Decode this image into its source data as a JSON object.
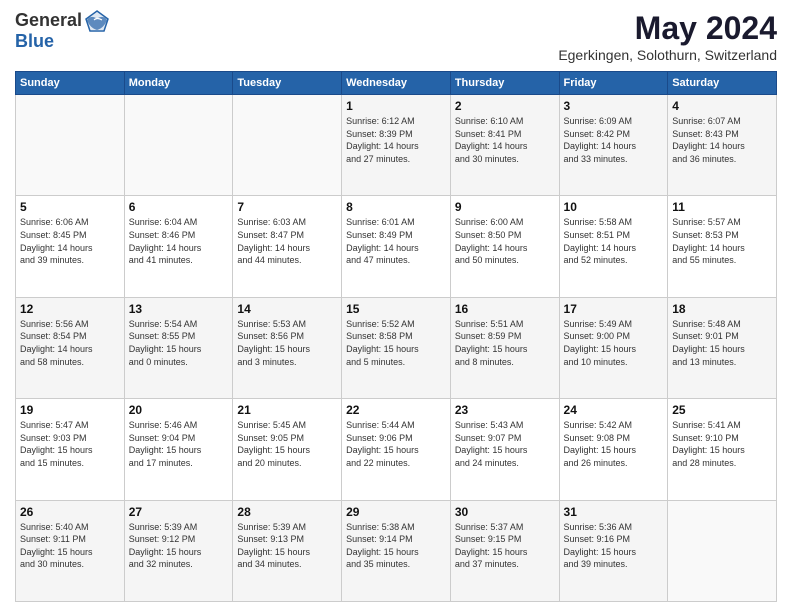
{
  "header": {
    "logo_line1": "General",
    "logo_line2": "Blue",
    "month_title": "May 2024",
    "location": "Egerkingen, Solothurn, Switzerland"
  },
  "weekdays": [
    "Sunday",
    "Monday",
    "Tuesday",
    "Wednesday",
    "Thursday",
    "Friday",
    "Saturday"
  ],
  "weeks": [
    [
      {
        "day": "",
        "info": ""
      },
      {
        "day": "",
        "info": ""
      },
      {
        "day": "",
        "info": ""
      },
      {
        "day": "1",
        "info": "Sunrise: 6:12 AM\nSunset: 8:39 PM\nDaylight: 14 hours\nand 27 minutes."
      },
      {
        "day": "2",
        "info": "Sunrise: 6:10 AM\nSunset: 8:41 PM\nDaylight: 14 hours\nand 30 minutes."
      },
      {
        "day": "3",
        "info": "Sunrise: 6:09 AM\nSunset: 8:42 PM\nDaylight: 14 hours\nand 33 minutes."
      },
      {
        "day": "4",
        "info": "Sunrise: 6:07 AM\nSunset: 8:43 PM\nDaylight: 14 hours\nand 36 minutes."
      }
    ],
    [
      {
        "day": "5",
        "info": "Sunrise: 6:06 AM\nSunset: 8:45 PM\nDaylight: 14 hours\nand 39 minutes."
      },
      {
        "day": "6",
        "info": "Sunrise: 6:04 AM\nSunset: 8:46 PM\nDaylight: 14 hours\nand 41 minutes."
      },
      {
        "day": "7",
        "info": "Sunrise: 6:03 AM\nSunset: 8:47 PM\nDaylight: 14 hours\nand 44 minutes."
      },
      {
        "day": "8",
        "info": "Sunrise: 6:01 AM\nSunset: 8:49 PM\nDaylight: 14 hours\nand 47 minutes."
      },
      {
        "day": "9",
        "info": "Sunrise: 6:00 AM\nSunset: 8:50 PM\nDaylight: 14 hours\nand 50 minutes."
      },
      {
        "day": "10",
        "info": "Sunrise: 5:58 AM\nSunset: 8:51 PM\nDaylight: 14 hours\nand 52 minutes."
      },
      {
        "day": "11",
        "info": "Sunrise: 5:57 AM\nSunset: 8:53 PM\nDaylight: 14 hours\nand 55 minutes."
      }
    ],
    [
      {
        "day": "12",
        "info": "Sunrise: 5:56 AM\nSunset: 8:54 PM\nDaylight: 14 hours\nand 58 minutes."
      },
      {
        "day": "13",
        "info": "Sunrise: 5:54 AM\nSunset: 8:55 PM\nDaylight: 15 hours\nand 0 minutes."
      },
      {
        "day": "14",
        "info": "Sunrise: 5:53 AM\nSunset: 8:56 PM\nDaylight: 15 hours\nand 3 minutes."
      },
      {
        "day": "15",
        "info": "Sunrise: 5:52 AM\nSunset: 8:58 PM\nDaylight: 15 hours\nand 5 minutes."
      },
      {
        "day": "16",
        "info": "Sunrise: 5:51 AM\nSunset: 8:59 PM\nDaylight: 15 hours\nand 8 minutes."
      },
      {
        "day": "17",
        "info": "Sunrise: 5:49 AM\nSunset: 9:00 PM\nDaylight: 15 hours\nand 10 minutes."
      },
      {
        "day": "18",
        "info": "Sunrise: 5:48 AM\nSunset: 9:01 PM\nDaylight: 15 hours\nand 13 minutes."
      }
    ],
    [
      {
        "day": "19",
        "info": "Sunrise: 5:47 AM\nSunset: 9:03 PM\nDaylight: 15 hours\nand 15 minutes."
      },
      {
        "day": "20",
        "info": "Sunrise: 5:46 AM\nSunset: 9:04 PM\nDaylight: 15 hours\nand 17 minutes."
      },
      {
        "day": "21",
        "info": "Sunrise: 5:45 AM\nSunset: 9:05 PM\nDaylight: 15 hours\nand 20 minutes."
      },
      {
        "day": "22",
        "info": "Sunrise: 5:44 AM\nSunset: 9:06 PM\nDaylight: 15 hours\nand 22 minutes."
      },
      {
        "day": "23",
        "info": "Sunrise: 5:43 AM\nSunset: 9:07 PM\nDaylight: 15 hours\nand 24 minutes."
      },
      {
        "day": "24",
        "info": "Sunrise: 5:42 AM\nSunset: 9:08 PM\nDaylight: 15 hours\nand 26 minutes."
      },
      {
        "day": "25",
        "info": "Sunrise: 5:41 AM\nSunset: 9:10 PM\nDaylight: 15 hours\nand 28 minutes."
      }
    ],
    [
      {
        "day": "26",
        "info": "Sunrise: 5:40 AM\nSunset: 9:11 PM\nDaylight: 15 hours\nand 30 minutes."
      },
      {
        "day": "27",
        "info": "Sunrise: 5:39 AM\nSunset: 9:12 PM\nDaylight: 15 hours\nand 32 minutes."
      },
      {
        "day": "28",
        "info": "Sunrise: 5:39 AM\nSunset: 9:13 PM\nDaylight: 15 hours\nand 34 minutes."
      },
      {
        "day": "29",
        "info": "Sunrise: 5:38 AM\nSunset: 9:14 PM\nDaylight: 15 hours\nand 35 minutes."
      },
      {
        "day": "30",
        "info": "Sunrise: 5:37 AM\nSunset: 9:15 PM\nDaylight: 15 hours\nand 37 minutes."
      },
      {
        "day": "31",
        "info": "Sunrise: 5:36 AM\nSunset: 9:16 PM\nDaylight: 15 hours\nand 39 minutes."
      },
      {
        "day": "",
        "info": ""
      }
    ]
  ]
}
